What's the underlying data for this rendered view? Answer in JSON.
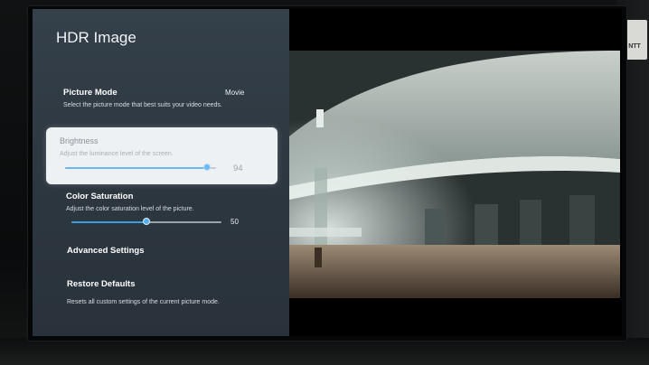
{
  "screen": {
    "title": "HDR Image",
    "menu": [
      {
        "title": "Picture Mode",
        "description": "Select the picture mode that best suits your video needs.",
        "value": "Movie"
      },
      {
        "title": "Brightness",
        "description": "Adjust the luminance level of the screen.",
        "value": "94",
        "level": 94,
        "focused": true
      },
      {
        "title": "Color Saturation",
        "description": "Adjust the color saturation level of the picture.",
        "value": "50",
        "level": 50
      },
      {
        "title": "Advanced Settings"
      },
      {
        "title": "Restore Defaults",
        "description": "Resets all custom settings of the current picture mode."
      }
    ]
  },
  "background": {
    "sticker": "NTT"
  },
  "colors": {
    "panel": "#2e3841",
    "accent": "#3d9be2",
    "focus_card": "#eef1f4"
  }
}
